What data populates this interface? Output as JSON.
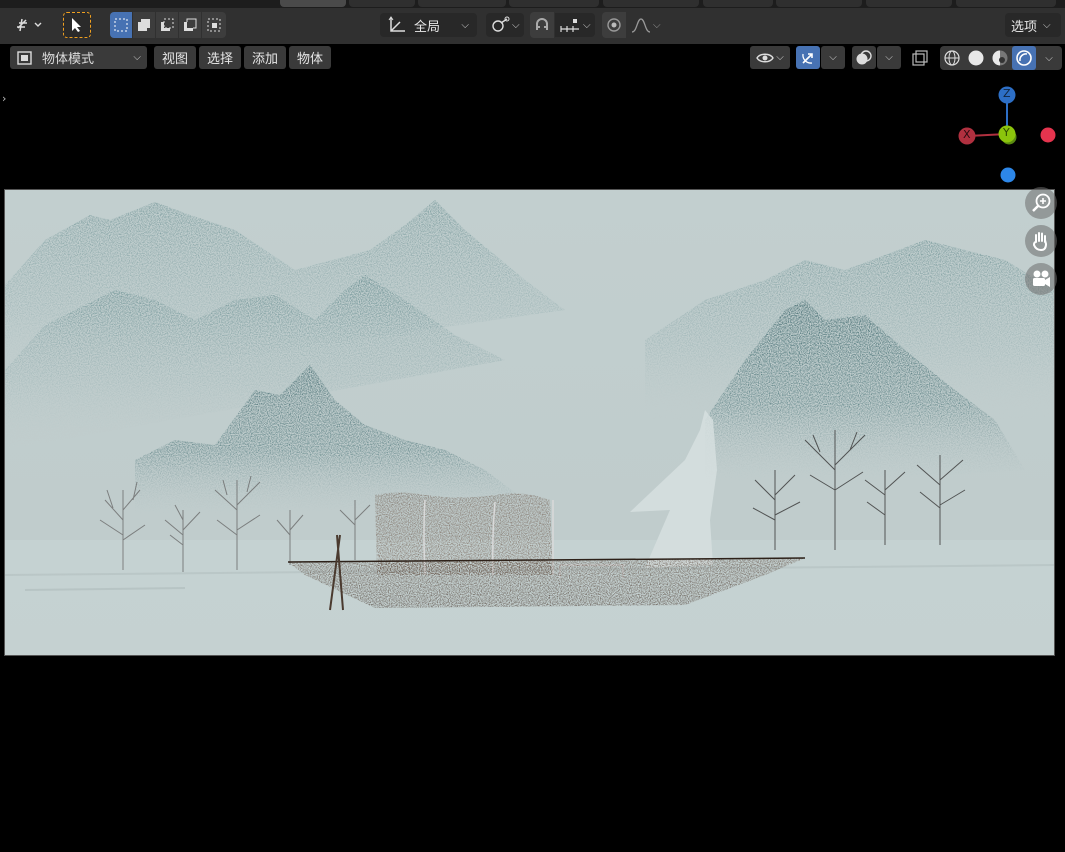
{
  "toolbar": {
    "transform_orientation": "全局",
    "options_label": "选项"
  },
  "viewport_header": {
    "mode": "物体模式",
    "menus": [
      "视图",
      "选择",
      "添加",
      "物体"
    ]
  },
  "gizmo": {
    "x_label": "X",
    "y_label": "Y",
    "z_label": "Z",
    "colors": {
      "x": "#e5344e",
      "y": "#8bc40c",
      "z": "#2d87e8"
    }
  },
  "theme": {
    "accent": "#4772b3",
    "select_box_highlight": "#f0a020"
  },
  "icons": {
    "workspace_tabs": "workspace-tabs",
    "tweak": "tweak-tool-icon",
    "select": "cursor-select-icon",
    "select_modes": [
      "select-box-icon",
      "select-extend-icon",
      "select-subtract-icon",
      "select-difference-icon",
      "select-intersect-icon"
    ],
    "pivot": "transform-pivot-icon",
    "snap": "snap-icon",
    "proportional": "proportional-edit-icon",
    "visibility": "eye-icon",
    "gizmo_toggle": "gizmo-toggle-icon",
    "overlays": "overlays-icon",
    "xray": "xray-icon",
    "shading": [
      "wireframe-shading-icon",
      "solid-shading-icon",
      "material-shading-icon",
      "rendered-shading-icon"
    ],
    "nav": [
      "zoom-icon",
      "pan-hand-icon",
      "camera-view-icon"
    ]
  }
}
